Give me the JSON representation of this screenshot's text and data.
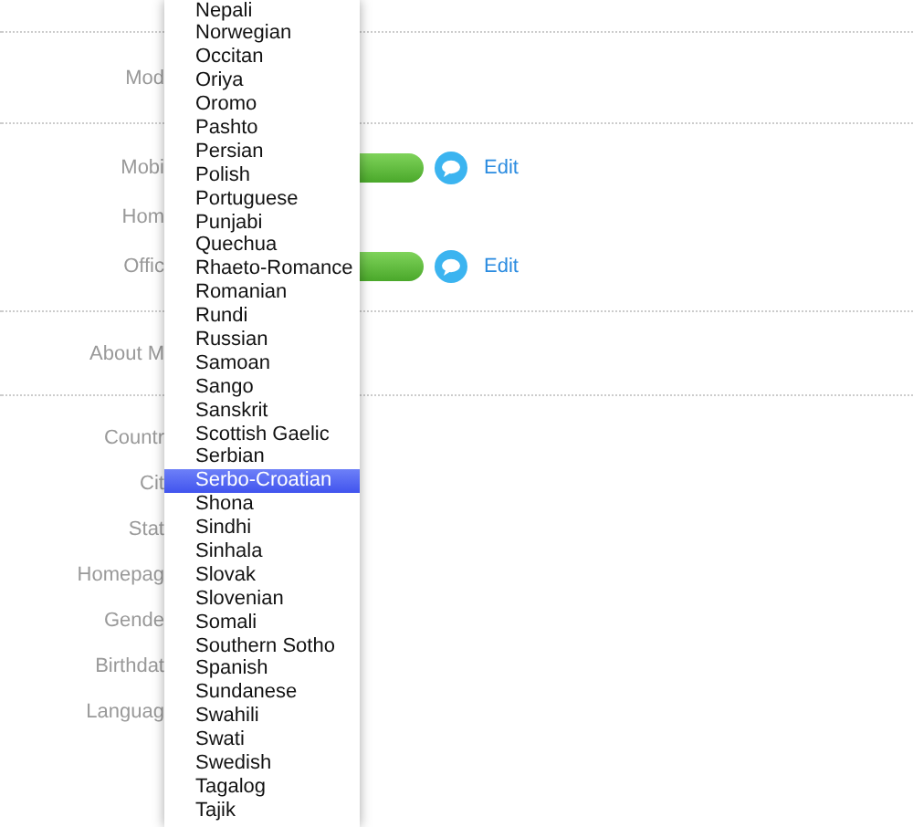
{
  "profile": {
    "sections": [
      {
        "rows": [
          {
            "label": "Mod",
            "kind": "plain"
          }
        ]
      },
      {
        "rows": [
          {
            "label": "Mobi",
            "kind": "phone",
            "edit": "Edit"
          },
          {
            "label": "Hom",
            "kind": "plain"
          },
          {
            "label": "Offic",
            "kind": "phone",
            "edit": "Edit"
          }
        ]
      },
      {
        "rows": [
          {
            "label": "About M",
            "kind": "plain"
          }
        ]
      },
      {
        "rows": [
          {
            "label": "Countr",
            "kind": "plain"
          },
          {
            "label": "Cit",
            "kind": "plain"
          },
          {
            "label": "Stat",
            "kind": "plain"
          },
          {
            "label": "Homepag",
            "kind": "plain"
          },
          {
            "label": "Gende",
            "kind": "plain"
          },
          {
            "label": "Birthdat",
            "kind": "plain"
          },
          {
            "label": "Languag",
            "kind": "plain"
          }
        ]
      }
    ]
  },
  "language_dropdown": {
    "options": [
      {
        "label": "Nepali",
        "selected": false
      },
      {
        "label": "Norwegian",
        "selected": false
      },
      {
        "label": "Occitan",
        "selected": false
      },
      {
        "label": "Oriya",
        "selected": false
      },
      {
        "label": "Oromo",
        "selected": false
      },
      {
        "label": "Pashto",
        "selected": false
      },
      {
        "label": "Persian",
        "selected": false
      },
      {
        "label": "Polish",
        "selected": false
      },
      {
        "label": "Portuguese",
        "selected": false
      },
      {
        "label": "Punjabi",
        "selected": false
      },
      {
        "label": "Quechua",
        "selected": false
      },
      {
        "label": "Rhaeto-Romance",
        "selected": false
      },
      {
        "label": "Romanian",
        "selected": false
      },
      {
        "label": "Rundi",
        "selected": false
      },
      {
        "label": "Russian",
        "selected": false
      },
      {
        "label": "Samoan",
        "selected": false
      },
      {
        "label": "Sango",
        "selected": false
      },
      {
        "label": "Sanskrit",
        "selected": false
      },
      {
        "label": "Scottish Gaelic",
        "selected": false
      },
      {
        "label": "Serbian",
        "selected": false
      },
      {
        "label": "Serbo-Croatian",
        "selected": true
      },
      {
        "label": "Shona",
        "selected": false
      },
      {
        "label": "Sindhi",
        "selected": false
      },
      {
        "label": "Sinhala",
        "selected": false
      },
      {
        "label": "Slovak",
        "selected": false
      },
      {
        "label": "Slovenian",
        "selected": false
      },
      {
        "label": "Somali",
        "selected": false
      },
      {
        "label": "Southern Sotho",
        "selected": false
      },
      {
        "label": "Spanish",
        "selected": false
      },
      {
        "label": "Sundanese",
        "selected": false
      },
      {
        "label": "Swahili",
        "selected": false
      },
      {
        "label": "Swati",
        "selected": false
      },
      {
        "label": "Swedish",
        "selected": false
      },
      {
        "label": "Tagalog",
        "selected": false
      },
      {
        "label": "Tajik",
        "selected": false
      }
    ]
  }
}
